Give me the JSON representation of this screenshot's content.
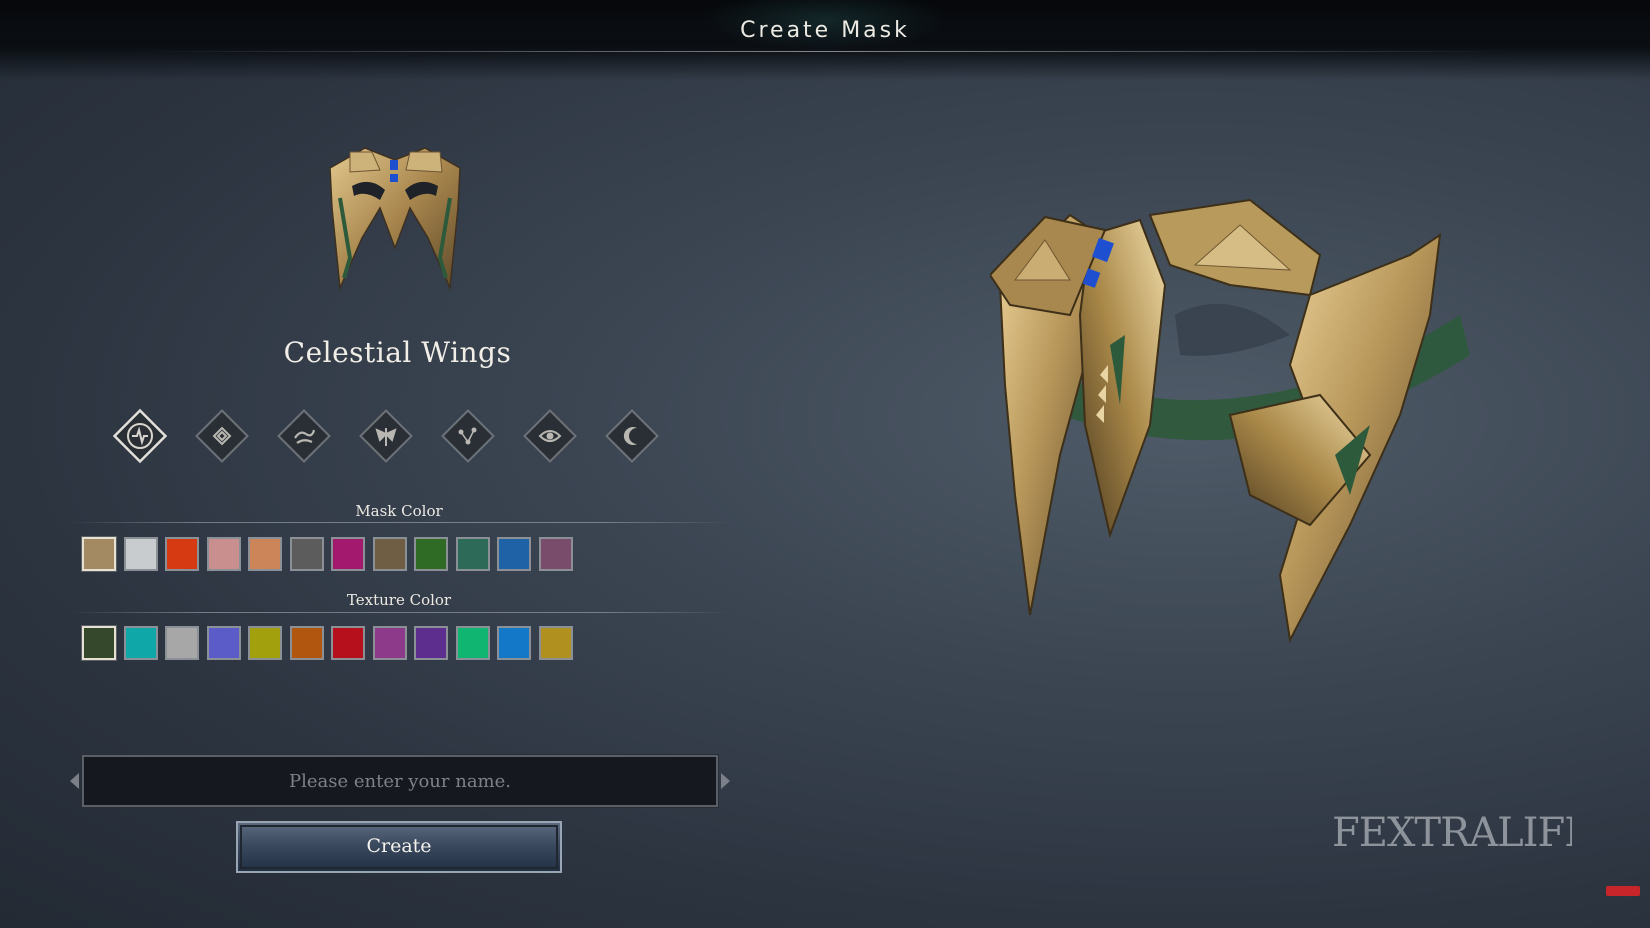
{
  "header": {
    "title": "Create Mask"
  },
  "mask": {
    "name": "Celestial Wings"
  },
  "sigils": [
    {
      "icon": "sigil-spark-icon",
      "selected": true
    },
    {
      "icon": "sigil-knot-icon",
      "selected": false
    },
    {
      "icon": "sigil-wave-icon",
      "selected": false
    },
    {
      "icon": "sigil-wings-icon",
      "selected": false
    },
    {
      "icon": "sigil-constellation-icon",
      "selected": false
    },
    {
      "icon": "sigil-eye-icon",
      "selected": false
    },
    {
      "icon": "sigil-moon-icon",
      "selected": false
    }
  ],
  "mask_color": {
    "label": "Mask Color",
    "swatches": [
      "#a38a62",
      "#c9ccce",
      "#d63a12",
      "#c98f8f",
      "#cc8558",
      "#5c5c5c",
      "#a3196e",
      "#6f5e44",
      "#2f6b25",
      "#2e6a58",
      "#1f63a6",
      "#7a4c6b"
    ],
    "selected_index": 0
  },
  "texture_color": {
    "label": "Texture Color",
    "swatches": [
      "#36482c",
      "#0fa7a7",
      "#a7a7a7",
      "#5b5cc7",
      "#a3a00e",
      "#b0560e",
      "#b5101b",
      "#8e3a8a",
      "#5e2e8e",
      "#10b572",
      "#1478c9",
      "#b0901f"
    ],
    "selected_index": 0
  },
  "name_input": {
    "placeholder": "Please enter your name.",
    "value": ""
  },
  "create_button": {
    "label": "Create"
  },
  "watermark": {
    "text": "FEXTRALIFE"
  },
  "colors": {
    "gold": "#b8975a",
    "gold_dark": "#6e5631",
    "green_inlay": "#2e5a3c",
    "gem_blue": "#1f4fd1"
  }
}
